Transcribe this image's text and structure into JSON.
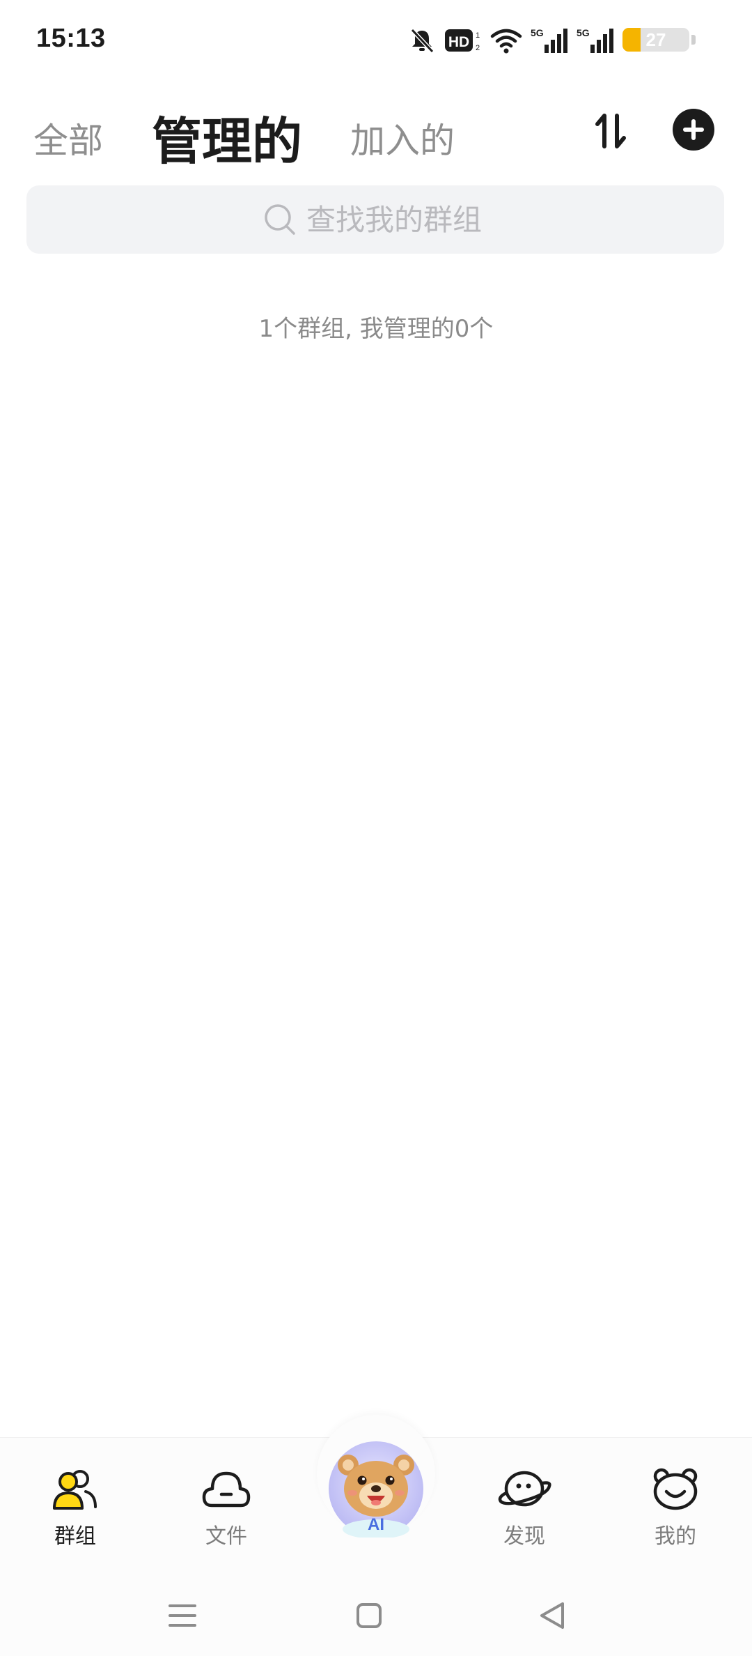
{
  "status_bar": {
    "time": "15:13",
    "hd_label": "HD",
    "network_label_1": "5G",
    "network_label_2": "5G",
    "battery_level": "27"
  },
  "header": {
    "tabs": [
      {
        "label": "全部",
        "active": false
      },
      {
        "label": "管理的",
        "active": true
      },
      {
        "label": "加入的",
        "active": false
      }
    ]
  },
  "search": {
    "placeholder": "查找我的群组",
    "value": ""
  },
  "summary": {
    "text": "1个群组, 我管理的0个"
  },
  "bottom_nav": {
    "items": [
      {
        "label": "群组",
        "icon": "groups-icon",
        "active": true
      },
      {
        "label": "文件",
        "icon": "cloud-file-icon",
        "active": false
      },
      {
        "label": "发现",
        "icon": "discover-planet-icon",
        "active": false
      },
      {
        "label": "我的",
        "icon": "bear-face-icon",
        "active": false
      }
    ],
    "ai_label": "AI"
  },
  "colors": {
    "accent": "#FFD814",
    "text_primary": "#1C1C1C",
    "text_secondary": "#8E8E8E",
    "search_bg": "#F2F3F5",
    "battery": "#F5B400"
  }
}
